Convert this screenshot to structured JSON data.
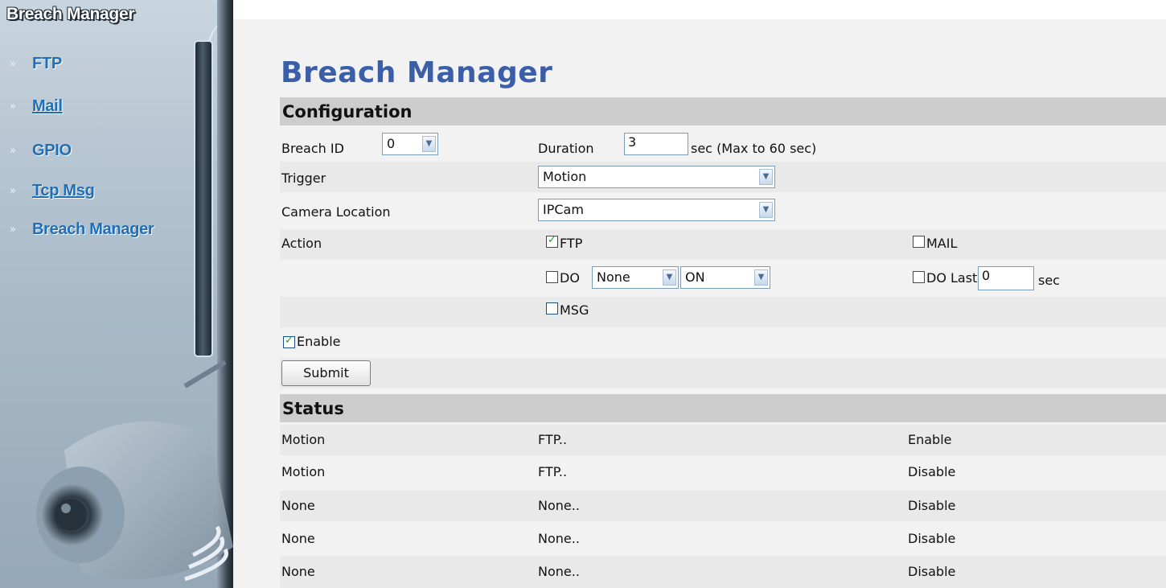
{
  "sidebar": {
    "title": "Breach Manager",
    "items": [
      {
        "label": "FTP"
      },
      {
        "label": "Mail"
      },
      {
        "label": "GPIO"
      },
      {
        "label": "Tcp Msg"
      },
      {
        "label": "Breach Manager"
      }
    ]
  },
  "page": {
    "title": "Breach Manager"
  },
  "configuration": {
    "header": "Configuration",
    "breach_id": {
      "label": "Breach ID",
      "value": "0"
    },
    "duration": {
      "label": "Duration",
      "value": "3",
      "suffix": "sec (Max to 60 sec)"
    },
    "trigger": {
      "label": "Trigger",
      "value": "Motion"
    },
    "camera_location": {
      "label": "Camera Location",
      "value": "IPCam"
    },
    "action": {
      "label": "Action",
      "ftp": {
        "label": "FTP",
        "checked": true
      },
      "mail": {
        "label": "MAIL",
        "checked": false
      },
      "do": {
        "label": "DO",
        "checked": false,
        "port": "None",
        "state": "ON"
      },
      "do_last": {
        "label": "DO Last",
        "checked": false,
        "value": "0",
        "suffix": "sec"
      },
      "msg": {
        "label": "MSG",
        "checked": false
      }
    },
    "enable": {
      "label": "Enable",
      "checked": true
    },
    "submit_label": "Submit"
  },
  "status": {
    "header": "Status",
    "rows": [
      {
        "trigger": "Motion",
        "action": "FTP..",
        "state": "Enable"
      },
      {
        "trigger": "Motion",
        "action": "FTP..",
        "state": "Disable"
      },
      {
        "trigger": "None",
        "action": "None..",
        "state": "Disable"
      },
      {
        "trigger": "None",
        "action": "None..",
        "state": "Disable"
      },
      {
        "trigger": "None",
        "action": "None..",
        "state": "Disable"
      }
    ]
  }
}
